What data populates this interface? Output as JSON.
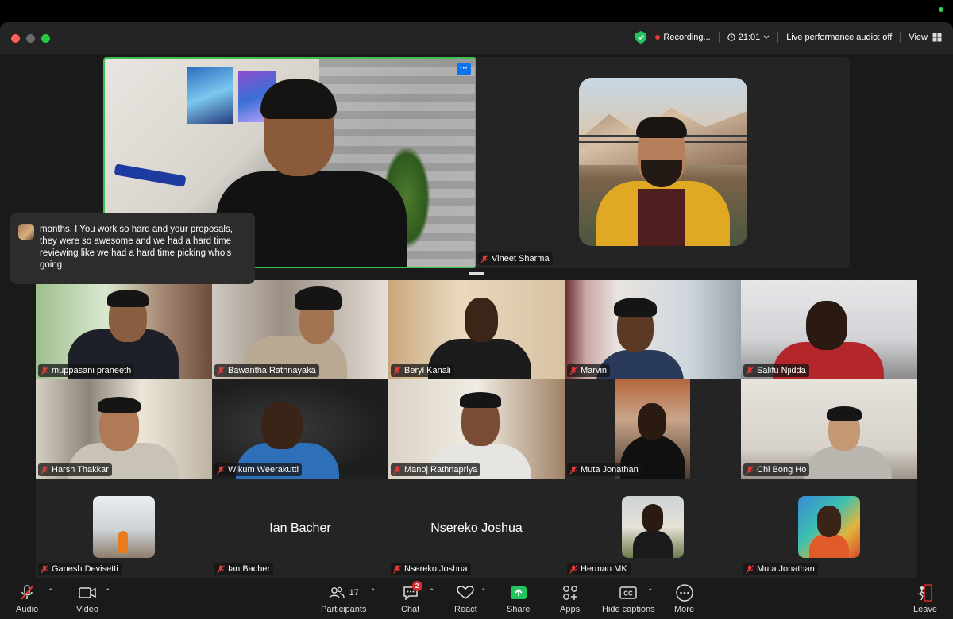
{
  "titlebar": {
    "recording_label": "Recording...",
    "timer": "21:01",
    "audio_label": "Live performance audio: off",
    "view_label": "View"
  },
  "speaker": {
    "more_label": "···"
  },
  "caption": {
    "text": "months. I You work so hard and your proposals, they were so awesome and we had a hard time reviewing like we had a hard time picking who's going"
  },
  "pinned": {
    "name": "Vineet Sharma"
  },
  "participants": [
    {
      "name": "muppasani praneeth"
    },
    {
      "name": "Bawantha Rathnayaka"
    },
    {
      "name": "Beryl Kanali"
    },
    {
      "name": "Marvin"
    },
    {
      "name": "Salifu Njidda"
    },
    {
      "name": "Harsh Thakkar"
    },
    {
      "name": "Wikum Weerakutti"
    },
    {
      "name": "Manoj Rathnapriya"
    },
    {
      "name": "Muta Jonathan"
    },
    {
      "name": "Chi Bong Ho"
    },
    {
      "name": "Ganesh Devisetti"
    },
    {
      "name": "Ian Bacher",
      "display": "Ian Bacher"
    },
    {
      "name": "Nsereko Joshua",
      "display": "Nsereko Joshua"
    },
    {
      "name": "Herman MK"
    },
    {
      "name": "Muta Jonathan"
    }
  ],
  "toolbar": {
    "audio": "Audio",
    "video": "Video",
    "participants": "Participants",
    "participants_count": "17",
    "chat": "Chat",
    "chat_badge": "2",
    "react": "React",
    "share": "Share",
    "apps": "Apps",
    "hide_captions": "Hide captions",
    "more": "More",
    "leave": "Leave"
  },
  "colors": {
    "active_speaker_border": "#3fbf4f",
    "share_green": "#22c55e",
    "leave_red": "#e02828",
    "more_button_blue": "#0e72ed"
  },
  "icons": [
    "shield-icon",
    "clock-icon",
    "microphone-off-icon",
    "video-camera-icon",
    "participants-icon",
    "chat-icon",
    "react-heart-icon",
    "share-arrow-icon",
    "apps-icon",
    "cc-icon",
    "more-dots-icon",
    "leave-door-icon"
  ]
}
